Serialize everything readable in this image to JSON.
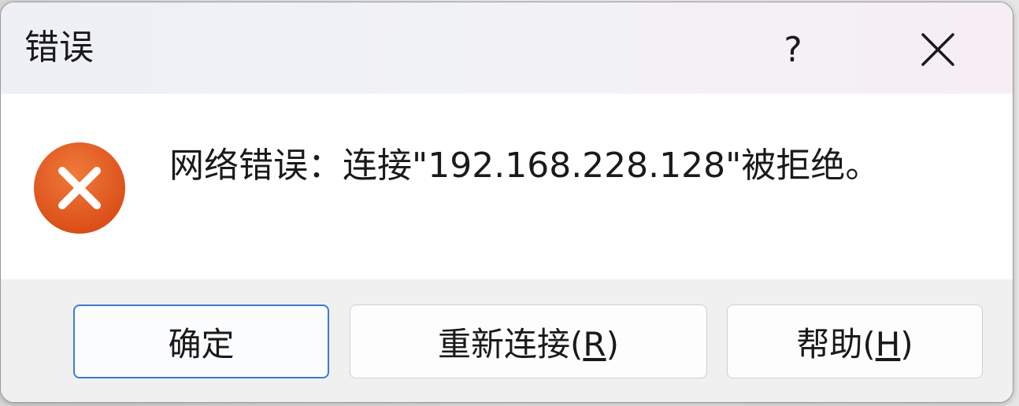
{
  "dialog": {
    "title": "错误",
    "help_label": "?",
    "close_icon": "close-icon",
    "message": "网络错误：连接\"192.168.228.128\"被拒绝。",
    "icon": "error-icon",
    "buttons": {
      "ok_label": "确定",
      "reconnect_prefix": "重新连接(",
      "reconnect_key": "R",
      "reconnect_suffix": ")",
      "help_prefix": "帮助(",
      "help_key": "H",
      "help_suffix": ")"
    },
    "colors": {
      "error_icon": "#e2581e",
      "primary_border": "#3a7bd5"
    }
  }
}
